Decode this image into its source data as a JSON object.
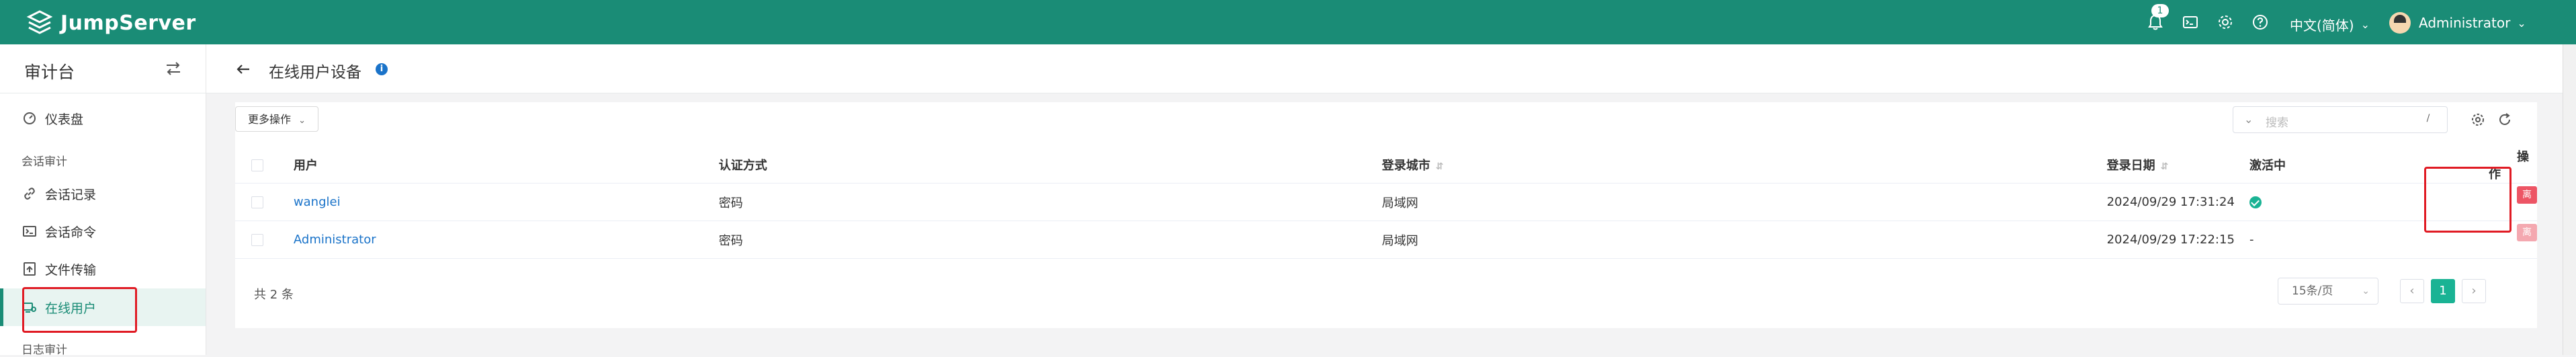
{
  "brand": {
    "name": "JumpServer"
  },
  "header": {
    "notification_count": "1",
    "language": "中文(简体)",
    "user_name": "Administrator"
  },
  "sidebar": {
    "title": "审计台",
    "items": [
      {
        "label": "仪表盘",
        "icon": "dashboard-icon"
      },
      {
        "label": "会话审计",
        "group": true
      },
      {
        "label": "会话记录",
        "icon": "link-icon"
      },
      {
        "label": "会话命令",
        "icon": "terminal-icon"
      },
      {
        "label": "文件传输",
        "icon": "file-transfer-icon"
      },
      {
        "label": "在线用户",
        "icon": "online-user-icon",
        "active": true
      },
      {
        "label": "日志审计",
        "group": true
      }
    ]
  },
  "page": {
    "title": "在线用户设备"
  },
  "toolbar": {
    "more_actions": "更多操作",
    "search_placeholder": "搜索",
    "search_shortcut": "/"
  },
  "table": {
    "columns": [
      "用户",
      "认证方式",
      "登录城市",
      "登录日期",
      "激活中",
      "操作"
    ],
    "rows": [
      {
        "user": "wanglei",
        "auth": "密码",
        "city": "局域网",
        "date": "2024/09/29 17:31:24",
        "active": true,
        "action": "离线"
      },
      {
        "user": "Administrator",
        "auth": "密码",
        "city": "局域网",
        "date": "2024/09/29 17:22:15",
        "active_text": "-",
        "action": "离线"
      }
    ]
  },
  "pagination": {
    "total": "共 2 条",
    "page_size": "15条/页",
    "current_page": "1",
    "prev": "‹",
    "next": "›"
  },
  "colors": {
    "brand": "#1a8c76",
    "danger": "#ed5565",
    "link": "#1a73c9",
    "success": "#1ab394"
  }
}
